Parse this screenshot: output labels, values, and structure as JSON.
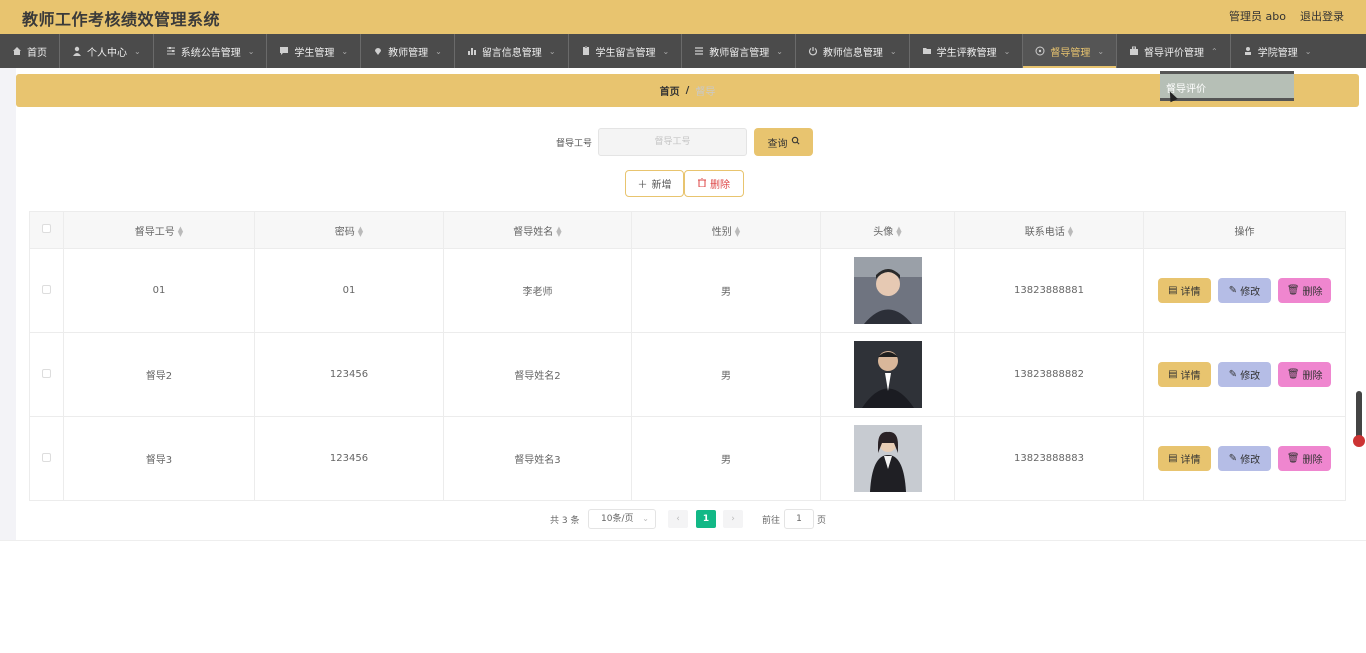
{
  "header": {
    "title": "教师工作考核绩效管理系统",
    "admin": "管理员 abo",
    "logout": "退出登录"
  },
  "nav": {
    "items": [
      {
        "label": "首页",
        "icon": "home-icon"
      },
      {
        "label": "个人中心",
        "icon": "user-icon"
      },
      {
        "label": "系统公告管理",
        "icon": "sliders-icon"
      },
      {
        "label": "学生管理",
        "icon": "chat-icon"
      },
      {
        "label": "教师管理",
        "icon": "location-icon"
      },
      {
        "label": "留言信息管理",
        "icon": "bar-chart-icon"
      },
      {
        "label": "学生留言管理",
        "icon": "clipboard-icon"
      },
      {
        "label": "教师留言管理",
        "icon": "list-icon"
      },
      {
        "label": "教师信息管理",
        "icon": "power-icon"
      },
      {
        "label": "学生评教管理",
        "icon": "folder-icon"
      },
      {
        "label": "督导管理",
        "icon": "compass-icon"
      },
      {
        "label": "督导评价管理",
        "icon": "briefcase-icon"
      },
      {
        "label": "学院管理",
        "icon": "person-icon"
      }
    ],
    "active_index": 10,
    "dropdown_item": "督导评价"
  },
  "breadcrumb": {
    "home": "首页",
    "separator": "/",
    "current": "督导"
  },
  "search": {
    "label": "督导工号",
    "placeholder": "督导工号",
    "button": "查询"
  },
  "actions": {
    "add": "新增",
    "delete": "删除"
  },
  "table": {
    "columns": [
      "督导工号",
      "密码",
      "督导姓名",
      "性别",
      "头像",
      "联系电话",
      "操作"
    ],
    "rows": [
      {
        "id": "01",
        "password": "01",
        "name": "李老师",
        "gender": "男",
        "phone": "13823888881"
      },
      {
        "id": "督导2",
        "password": "123456",
        "name": "督导姓名2",
        "gender": "男",
        "phone": "13823888882"
      },
      {
        "id": "督导3",
        "password": "123456",
        "name": "督导姓名3",
        "gender": "男",
        "phone": "13823888883"
      }
    ],
    "row_actions": {
      "detail": "详情",
      "edit": "修改",
      "remove": "删除"
    }
  },
  "pager": {
    "total": "共 3 条",
    "page_size": "10条/页",
    "current_page": "1",
    "goto_prefix": "前往",
    "goto_value": "1",
    "goto_suffix": "页"
  },
  "colors": {
    "accent": "#e8c46f",
    "nav_bg": "#4b4b4b",
    "page_active": "#12b886",
    "edit_btn": "#b5bde6",
    "remove_btn": "#ef86cf"
  }
}
